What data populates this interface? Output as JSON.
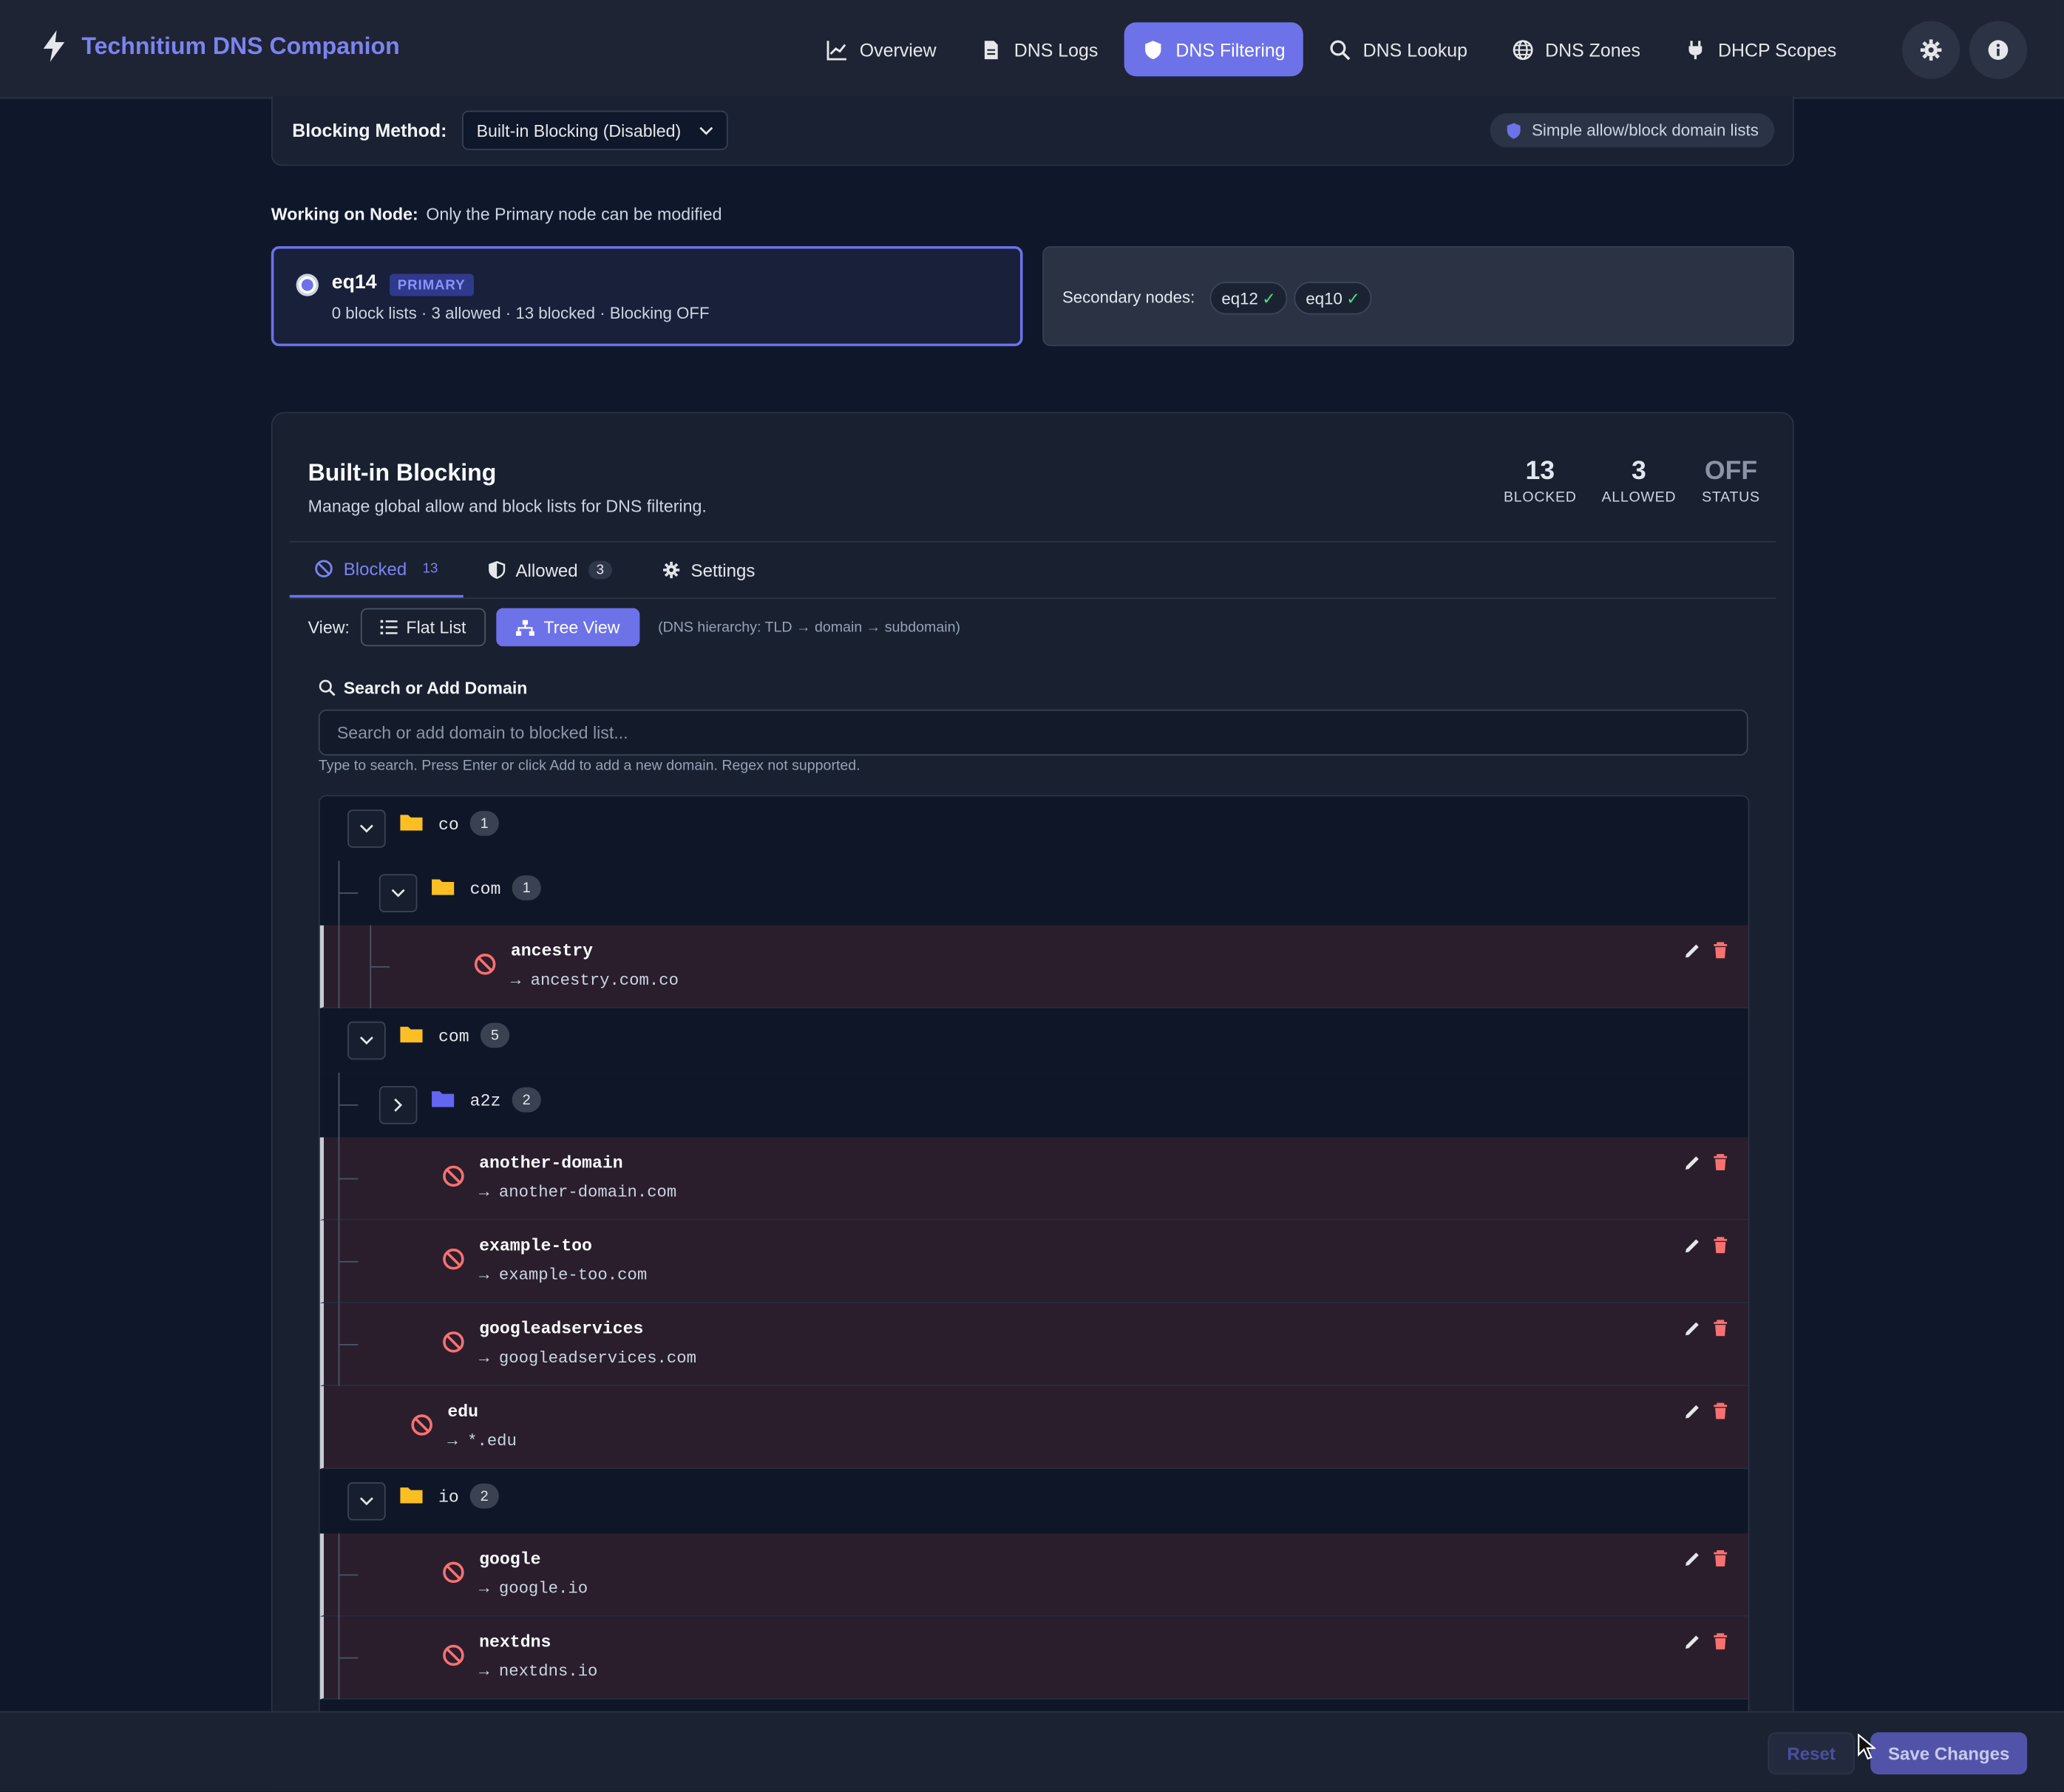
{
  "app": {
    "title": "Technitium DNS Companion"
  },
  "nav": [
    {
      "label": "Overview",
      "icon": "chart-line-icon"
    },
    {
      "label": "DNS Logs",
      "icon": "document-icon"
    },
    {
      "label": "DNS Filtering",
      "icon": "shield-icon",
      "active": true
    },
    {
      "label": "DNS Lookup",
      "icon": "search-icon"
    },
    {
      "label": "DNS Zones",
      "icon": "globe-icon"
    },
    {
      "label": "DHCP Scopes",
      "icon": "plug-icon"
    }
  ],
  "method": {
    "label": "Blocking Method:",
    "selected": "Built-in Blocking (Disabled)",
    "pill": "Simple allow/block domain lists"
  },
  "node_section": {
    "heading": "Working on Node:",
    "note": "Only the Primary node can be modified",
    "primary": {
      "name": "eq14",
      "badge": "PRIMARY",
      "stats": "0 block lists · 3 allowed · 13 blocked · Blocking OFF"
    },
    "secondary": {
      "label": "Secondary nodes:",
      "nodes": [
        {
          "name": "eq12",
          "check": "✓"
        },
        {
          "name": "eq10",
          "check": "✓"
        }
      ]
    }
  },
  "panel": {
    "title": "Built-in Blocking",
    "subtitle": "Manage global allow and block lists for DNS filtering.",
    "stats": [
      {
        "value": "13",
        "label": "BLOCKED"
      },
      {
        "value": "3",
        "label": "ALLOWED"
      },
      {
        "value": "OFF",
        "label": "STATUS"
      }
    ],
    "tabs": [
      {
        "label": "Blocked",
        "count": "13"
      },
      {
        "label": "Allowed",
        "count": "3"
      },
      {
        "label": "Settings"
      }
    ],
    "view": {
      "label": "View:",
      "flat": "Flat List",
      "tree": "Tree View",
      "hint": "(DNS hierarchy: TLD → domain → subdomain)"
    },
    "search": {
      "title": "Search or Add Domain",
      "placeholder": "Search or add domain to blocked list...",
      "help": "Type to search. Press Enter or click Add to add a new domain. Regex not supported."
    },
    "tree": {
      "folders": [
        {
          "name": "co",
          "count": "1"
        },
        {
          "name": "com",
          "count": "1"
        },
        {
          "name": "com",
          "count": "5"
        },
        {
          "name": "a2z",
          "count": "2"
        },
        {
          "name": "io",
          "count": "2"
        }
      ],
      "leaves": [
        {
          "name": "ancestry",
          "full": "→ ancestry.com.co"
        },
        {
          "name": "another-domain",
          "full": "→ another-domain.com"
        },
        {
          "name": "example-too",
          "full": "→ example-too.com"
        },
        {
          "name": "googleadservices",
          "full": "→ googleadservices.com"
        },
        {
          "name": "edu",
          "full": "→ *.edu"
        },
        {
          "name": "google",
          "full": "→ google.io"
        },
        {
          "name": "nextdns",
          "full": "→ nextdns.io"
        }
      ]
    }
  },
  "footer": {
    "reset": "Reset",
    "save": "Save Changes"
  },
  "colors": {
    "accent": "#6d72e8",
    "blocked_row": "#2a1e2c",
    "danger": "#f87171",
    "folder_yellow": "#fbbf24",
    "folder_blue": "#6366f1"
  }
}
